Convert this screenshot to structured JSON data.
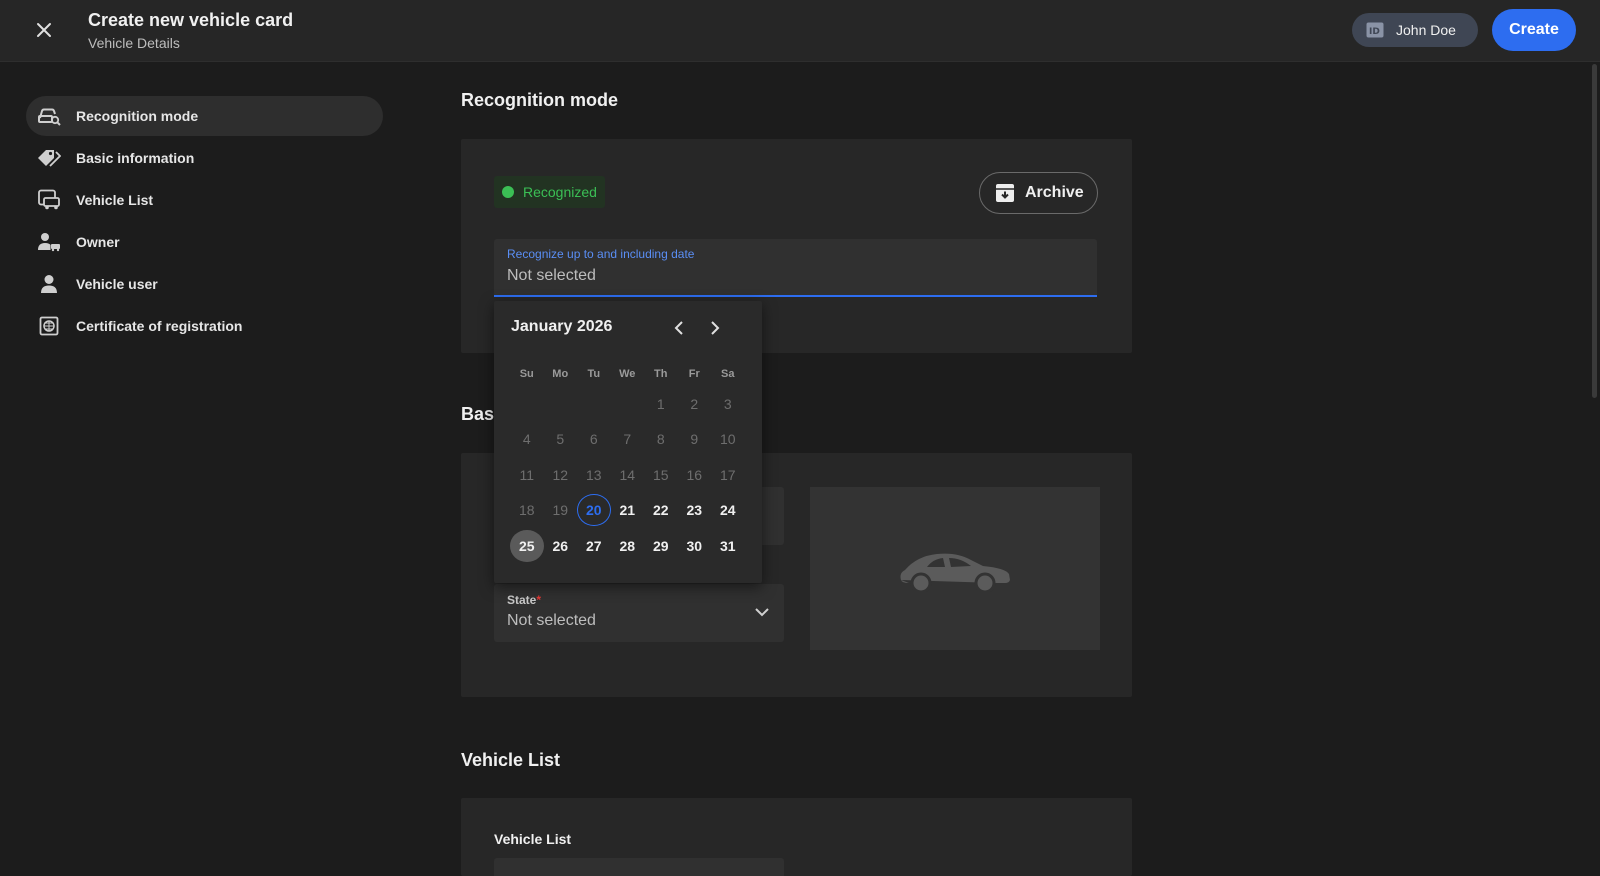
{
  "header": {
    "title": "Create new vehicle card",
    "subtitle": "Vehicle Details",
    "user_name": "John Doe",
    "create_label": "Create"
  },
  "sidebar": {
    "items": [
      {
        "label": "Recognition mode",
        "icon": "car-search-icon",
        "active": true
      },
      {
        "label": "Basic information",
        "icon": "tags-icon",
        "active": false
      },
      {
        "label": "Vehicle List",
        "icon": "vehicle-list-icon",
        "active": false
      },
      {
        "label": "Owner",
        "icon": "owner-icon",
        "active": false
      },
      {
        "label": "Vehicle user",
        "icon": "person-icon",
        "active": false
      },
      {
        "label": "Certificate of registration",
        "icon": "certificate-icon",
        "active": false
      }
    ]
  },
  "recognition": {
    "section_title": "Recognition mode",
    "status": "Recognized",
    "status_color": "#3bbf55",
    "archive_label": "Archive",
    "date_label": "Recognize up to and including date",
    "date_value": "Not selected"
  },
  "calendar": {
    "month_label": "January 2026",
    "weekdays": [
      "Su",
      "Mo",
      "Tu",
      "We",
      "Th",
      "Fr",
      "Sa"
    ],
    "weeks": [
      [
        "",
        "",
        "",
        "",
        "1",
        "2",
        "3"
      ],
      [
        "4",
        "5",
        "6",
        "7",
        "8",
        "9",
        "10"
      ],
      [
        "11",
        "12",
        "13",
        "14",
        "15",
        "16",
        "17"
      ],
      [
        "18",
        "19",
        "20",
        "21",
        "22",
        "23",
        "24"
      ],
      [
        "25",
        "26",
        "27",
        "28",
        "29",
        "30",
        "31"
      ]
    ],
    "today": "20",
    "selected": "25",
    "first_enabled_day": 20
  },
  "basic": {
    "section_title": "Bas",
    "state_label": "State",
    "state_required_mark": "*",
    "state_value": "Not selected"
  },
  "vehicle_list": {
    "section_title": "Vehicle List",
    "field_label": "Vehicle List"
  },
  "colors": {
    "accent": "#2d6df0",
    "background": "#1c1c1c",
    "card": "#272727"
  }
}
